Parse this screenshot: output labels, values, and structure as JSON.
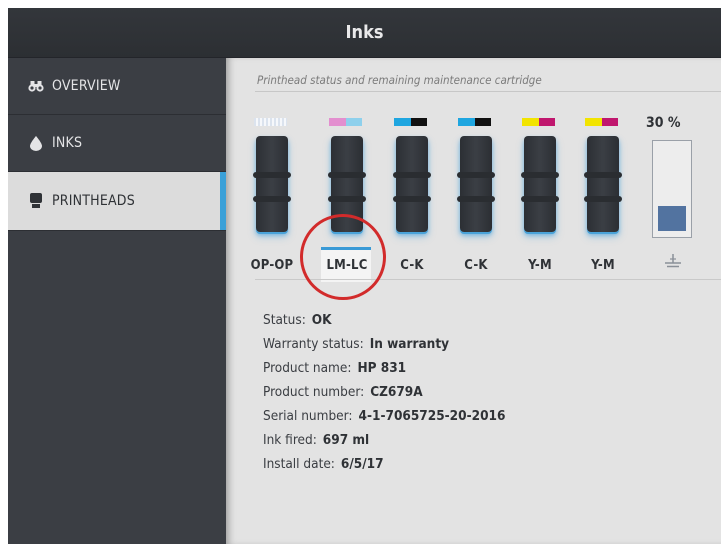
{
  "window": {
    "title": "Inks"
  },
  "sidebar": {
    "items": [
      {
        "label": "OVERVIEW",
        "icon": "binoculars-icon"
      },
      {
        "label": "INKS",
        "icon": "ink-drop-icon"
      },
      {
        "label": "PRINTHEADS",
        "icon": "printhead-icon",
        "active": true
      }
    ]
  },
  "main": {
    "subtitle": "Printhead status and remaining maintenance cartridge",
    "printheads": [
      {
        "label": "OP-OP",
        "colors": [
          "#e9edf3",
          "#e9edf3"
        ]
      },
      {
        "label": "LM-LC",
        "colors": [
          "#e38fcf",
          "#8ed0ec"
        ],
        "selected": true
      },
      {
        "label": "C-K",
        "colors": [
          "#1fa6e0",
          "#111111"
        ]
      },
      {
        "label": "C-K",
        "colors": [
          "#1fa6e0",
          "#111111"
        ]
      },
      {
        "label": "Y-M",
        "colors": [
          "#f2e400",
          "#c0176e"
        ]
      },
      {
        "label": "Y-M",
        "colors": [
          "#f2e400",
          "#c0176e"
        ]
      }
    ],
    "maintenance": {
      "percent_label": "30 %",
      "level": 0.3,
      "icon": "maintenance-cartridge-icon"
    },
    "details": [
      {
        "label": "Status:",
        "value": "OK"
      },
      {
        "label": "Warranty status:",
        "value": "In warranty"
      },
      {
        "label": "Product name:",
        "value": "HP 831"
      },
      {
        "label": "Product number:",
        "value": "CZ679A"
      },
      {
        "label": "Serial number:",
        "value": "4-1-7065725-20-2016"
      },
      {
        "label": "Ink fired:",
        "value": "697 ml"
      },
      {
        "label": "Install date:",
        "value": "6/5/17"
      }
    ]
  },
  "annotation": {
    "highlight_color": "#d22b2b"
  }
}
